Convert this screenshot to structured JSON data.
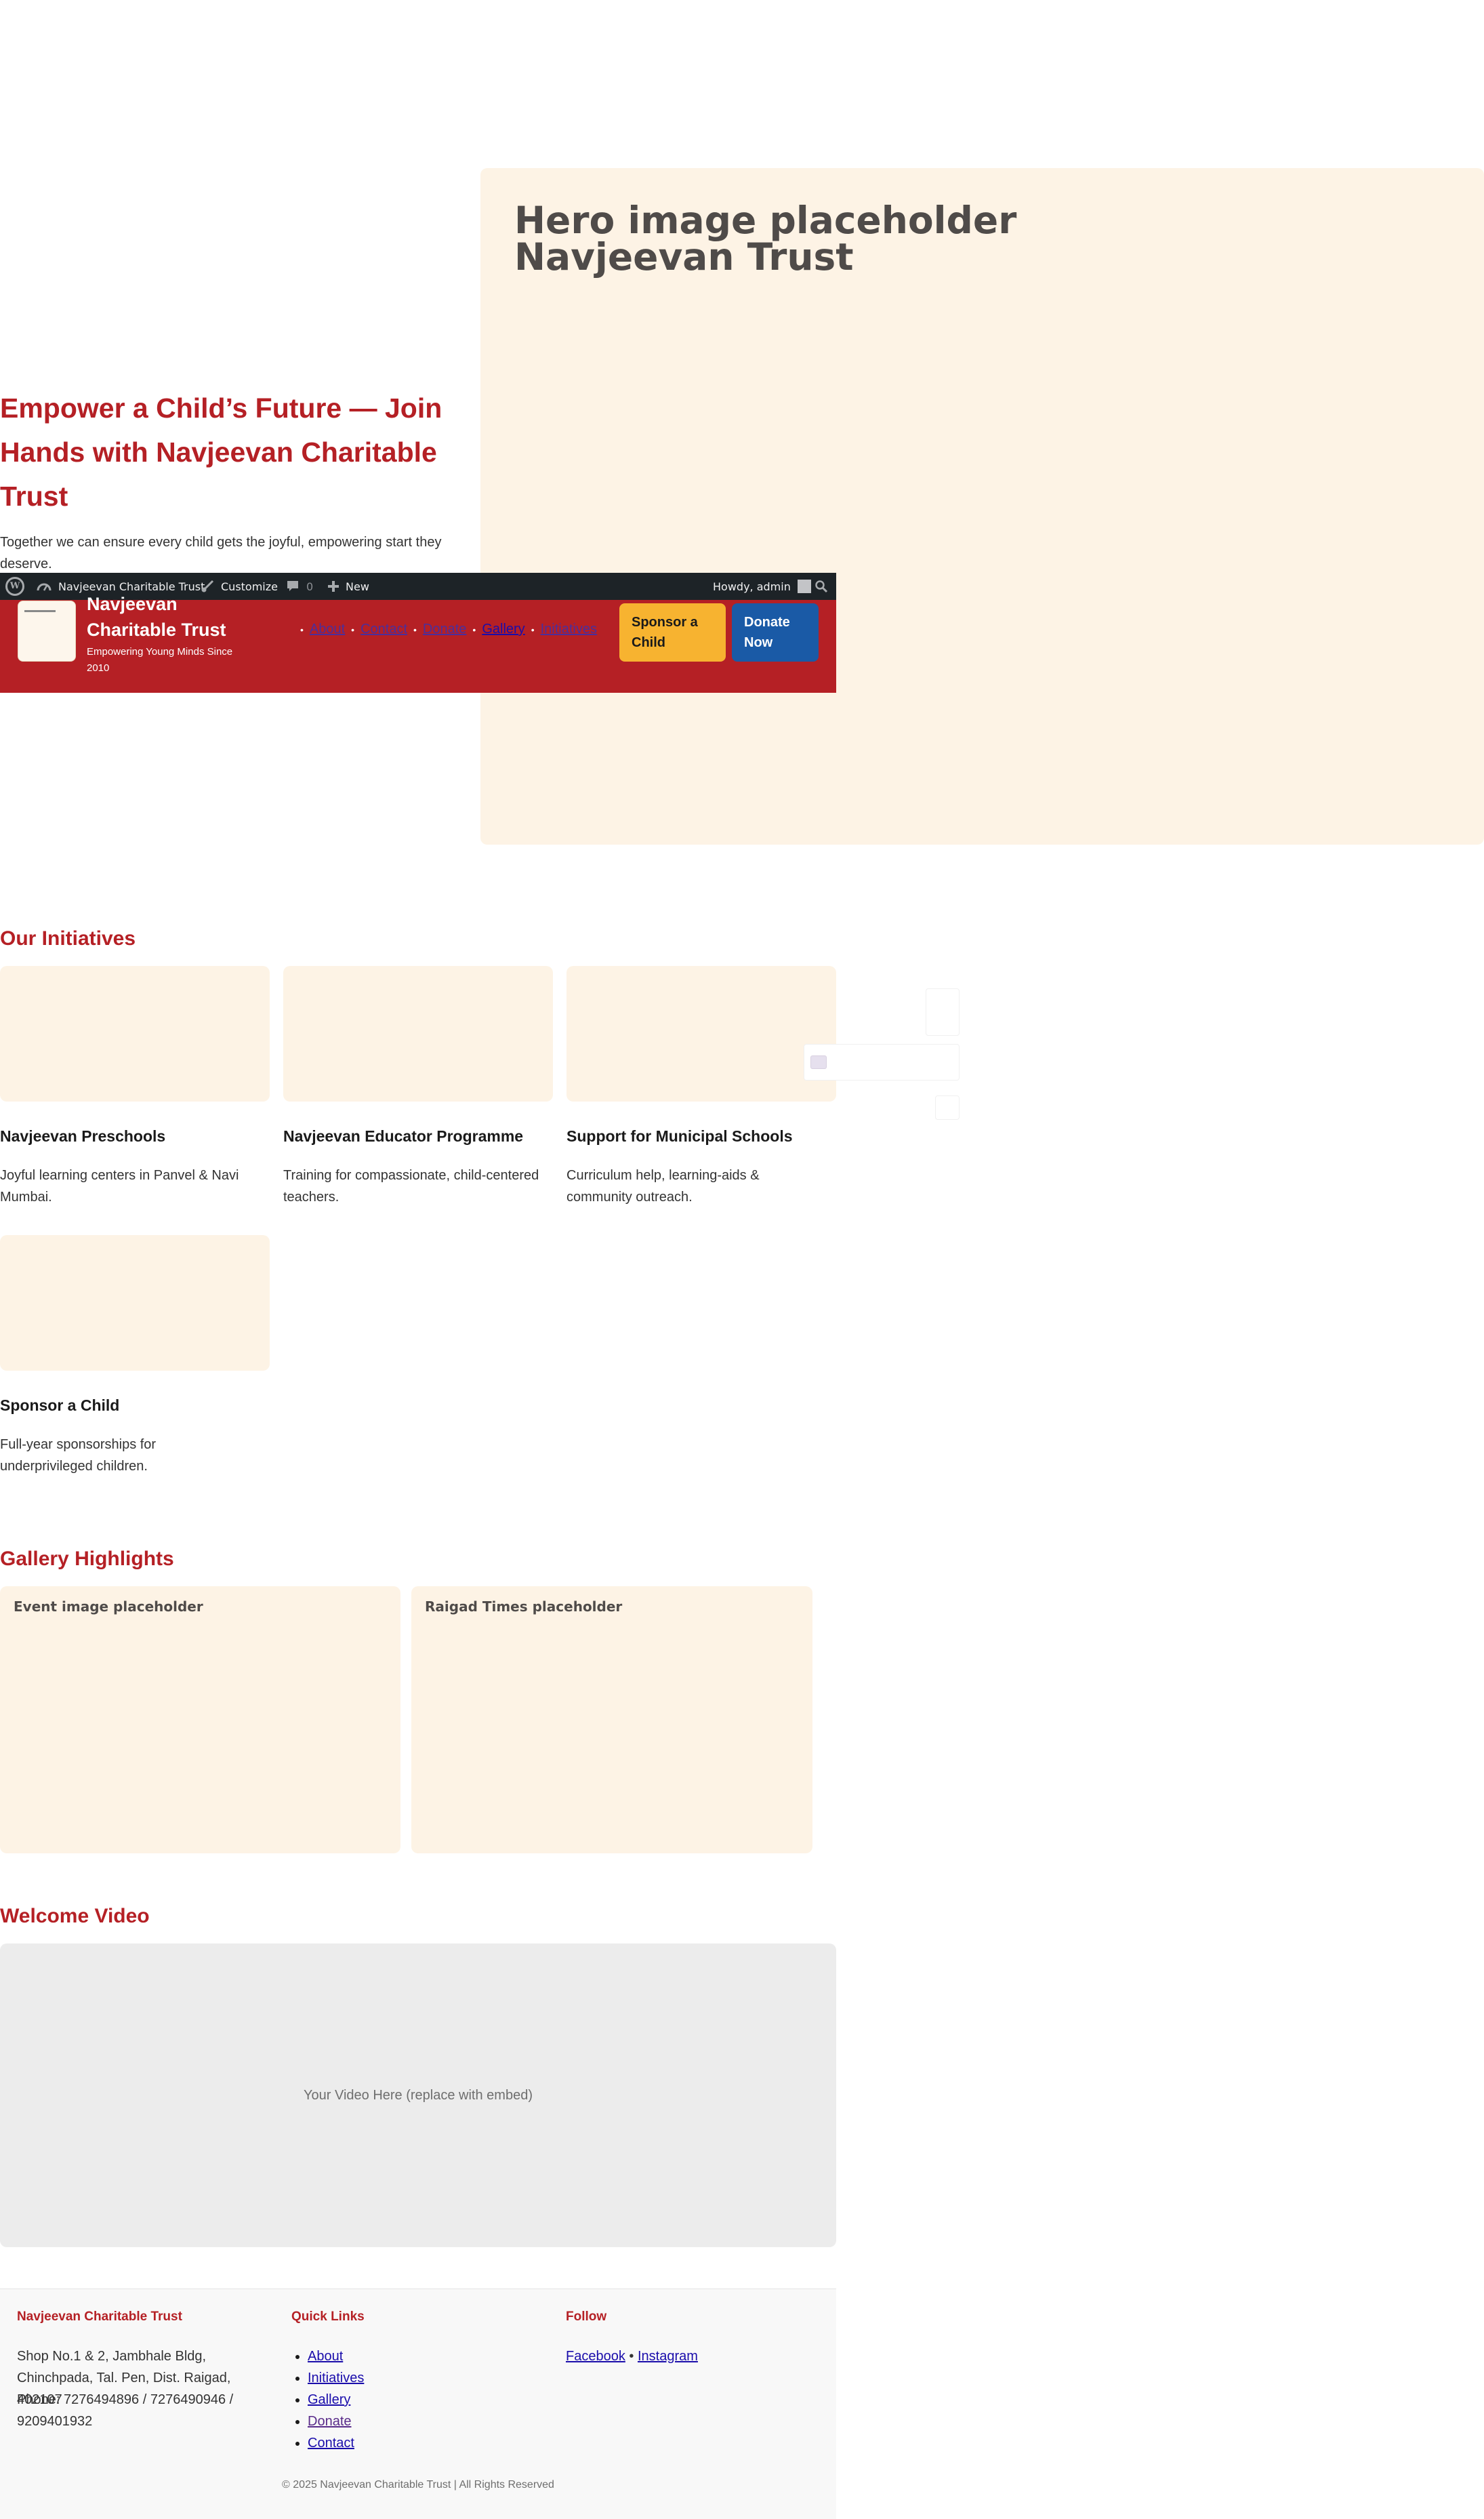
{
  "hero": {
    "title": "Empower a Child’s Future — Join Hands with Navjeevan Charitable Trust",
    "subtitle": "Together we can ensure every child gets the joyful, empowering start they deserve.",
    "image_placeholder": "Hero image placeholder Navjeevan Trust"
  },
  "adminbar": {
    "site_name": "Navjeevan Charitable Trust",
    "customize": "Customize",
    "comments_count": "0",
    "new": "New",
    "howdy": "Howdy, admin",
    "icons": [
      "wordpress-logo",
      "dashboard",
      "paintbrush",
      "comment",
      "plus",
      "avatar",
      "search"
    ]
  },
  "header": {
    "site_name": "Navjeevan Charitable Trust",
    "tagline": "Empowering Young Minds Since 2010",
    "nav": [
      "About",
      "Contact",
      "Donate",
      "Gallery",
      "Initiatives"
    ],
    "sponsor_button": "Sponsor a Child",
    "donate_button": "Donate Now"
  },
  "initiatives": {
    "heading": "Our Initiatives",
    "cards": [
      {
        "title": "Navjeevan Preschools",
        "desc": "Joyful learning centers in Panvel & Navi Mumbai."
      },
      {
        "title": "Navjeevan Educator Programme",
        "desc": "Training for compassionate, child-centered teachers."
      },
      {
        "title": "Support for Municipal Schools",
        "desc": "Curriculum help, learning-aids & community outreach."
      },
      {
        "title": "Sponsor a Child",
        "desc": "Full-year sponsorships for underprivileged children."
      }
    ]
  },
  "gallery": {
    "heading": "Gallery Highlights",
    "items": [
      "Event image placeholder",
      "Raigad Times placeholder"
    ]
  },
  "video": {
    "heading": "Welcome Video",
    "placeholder": "Your Video Here (replace with embed)"
  },
  "footer": {
    "org_heading": "Navjeevan Charitable Trust",
    "address": "Shop No.1 & 2, Jambhale Bldg, Chinchpada, Tal. Pen, Dist. Raigad, 402107",
    "phone": "Phone: 7276494896 / 7276490946 / 9209401932",
    "quick_links_heading": "Quick Links",
    "quick_links": [
      "About",
      "Initiatives",
      "Gallery",
      "Donate",
      "Contact"
    ],
    "follow_heading": "Follow",
    "follow_links": [
      "Facebook",
      "Instagram"
    ],
    "follow_separator": "•",
    "copyright": "© 2025 Navjeevan Charitable Trust | All Rights Reserved"
  },
  "colors": {
    "brand_red": "#b52025",
    "cream": "#fdf3e5",
    "sponsor_yellow": "#f7b330",
    "donate_blue": "#1a5aa6",
    "adminbar_dark": "#1d2327"
  }
}
